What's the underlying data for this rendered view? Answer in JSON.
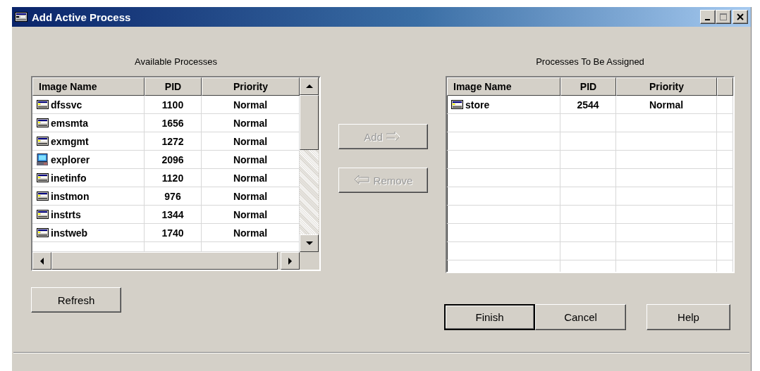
{
  "window": {
    "title": "Add Active Process",
    "controls": [
      {
        "kind": "minimize",
        "disabled": false
      },
      {
        "kind": "maximize",
        "disabled": true
      },
      {
        "kind": "close",
        "disabled": false
      }
    ]
  },
  "available": {
    "label": "Available Processes",
    "columns": [
      "Image Name",
      "PID",
      "Priority"
    ],
    "rows": [
      {
        "kind": "service",
        "image_name": "dfssvc",
        "pid": "1100",
        "priority": "Normal"
      },
      {
        "kind": "service",
        "image_name": "emsmta",
        "pid": "1656",
        "priority": "Normal"
      },
      {
        "kind": "service",
        "image_name": "exmgmt",
        "pid": "1272",
        "priority": "Normal"
      },
      {
        "kind": "desktop",
        "image_name": "explorer",
        "pid": "2096",
        "priority": "Normal"
      },
      {
        "kind": "service",
        "image_name": "inetinfo",
        "pid": "1120",
        "priority": "Normal"
      },
      {
        "kind": "service",
        "image_name": "instmon",
        "pid": "976",
        "priority": "Normal"
      },
      {
        "kind": "service",
        "image_name": "instrts",
        "pid": "1344",
        "priority": "Normal"
      },
      {
        "kind": "service",
        "image_name": "instweb",
        "pid": "1740",
        "priority": "Normal"
      }
    ]
  },
  "middle_buttons": [
    {
      "kind": "add",
      "label": "Add",
      "disabled": true
    },
    {
      "kind": "remove",
      "label": "Remove",
      "disabled": true
    }
  ],
  "assigned": {
    "label": "Processes To Be Assigned",
    "columns": [
      "Image Name",
      "PID",
      "Priority"
    ],
    "rows": [
      {
        "kind": "service",
        "image_name": "store",
        "pid": "2544",
        "priority": "Normal"
      }
    ]
  },
  "refresh_button": {
    "label": "Refresh"
  },
  "dialog_buttons": [
    {
      "label": "Finish",
      "default": true
    },
    {
      "label": "Cancel",
      "default": false
    },
    {
      "label": "Help",
      "default": false
    }
  ]
}
